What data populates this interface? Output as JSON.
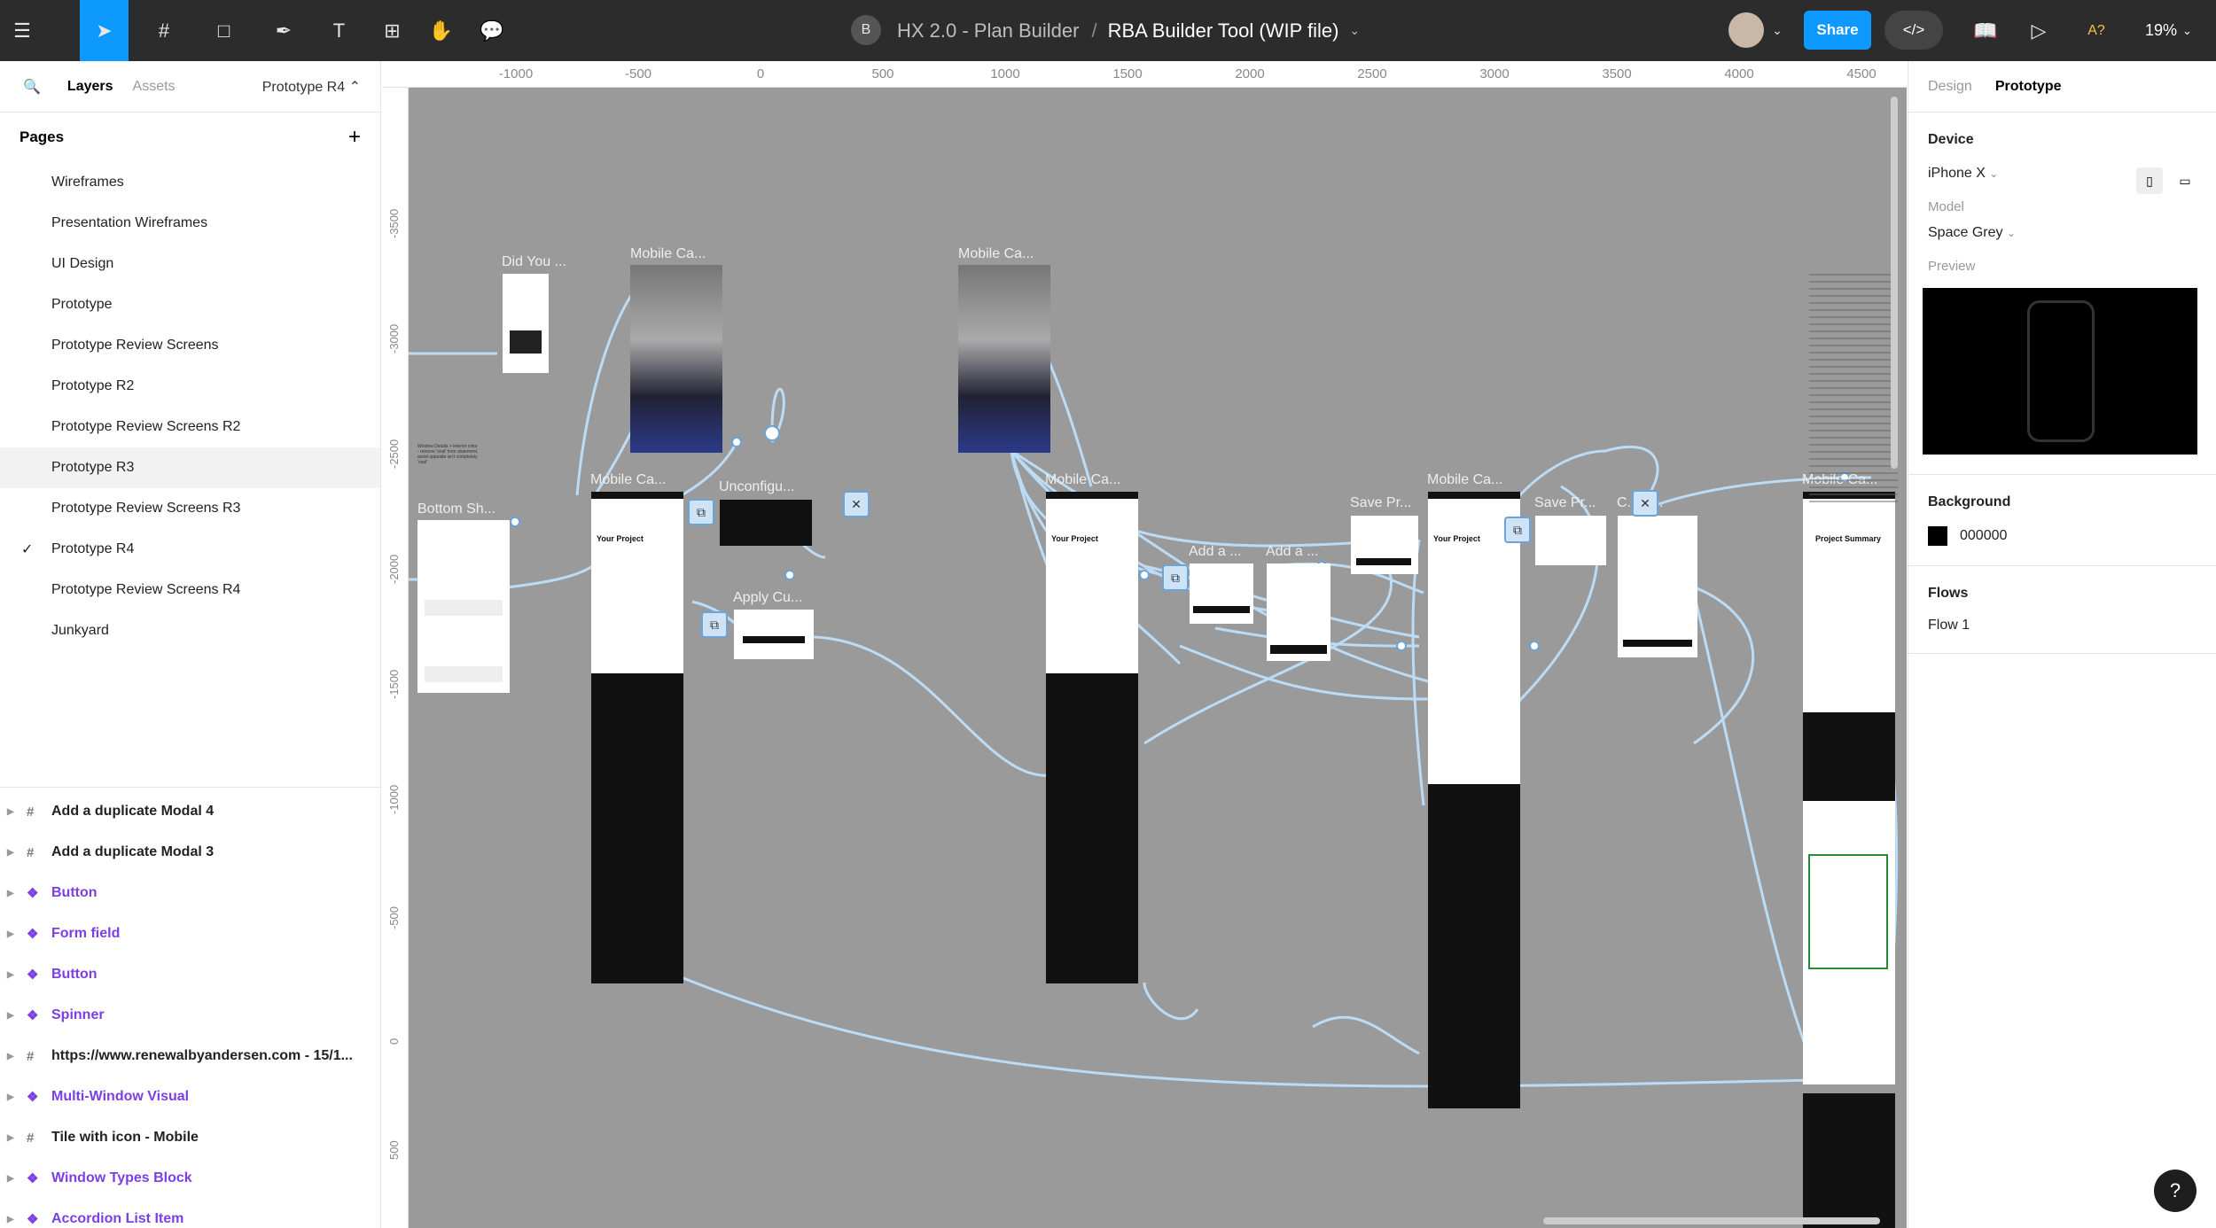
{
  "toolbar": {
    "user_initial": "B",
    "project": "HX 2.0 - Plan Builder",
    "separator": "/",
    "file": "RBA Builder Tool (WIP file)",
    "share_label": "Share",
    "zoom": "19%",
    "font_warning": "A?"
  },
  "left_panel": {
    "tab_layers": "Layers",
    "tab_assets": "Assets",
    "current_page": "Prototype R4",
    "pages_heading": "Pages",
    "pages": [
      "Wireframes",
      "Presentation Wireframes",
      "UI Design",
      "Prototype",
      "Prototype Review Screens",
      "Prototype R2",
      "Prototype Review Screens R2",
      "Prototype R3",
      "Prototype Review Screens R3",
      "Prototype R4",
      "Prototype Review Screens R4",
      "Junkyard"
    ],
    "layers": [
      {
        "label": "Add a duplicate Modal 4",
        "kind": "frame"
      },
      {
        "label": "Add a duplicate Modal 3",
        "kind": "frame"
      },
      {
        "label": "Button",
        "kind": "component"
      },
      {
        "label": "Form field",
        "kind": "component"
      },
      {
        "label": "Button",
        "kind": "component"
      },
      {
        "label": "Spinner",
        "kind": "component"
      },
      {
        "label": "https://www.renewalbyandersen.com - 15/1...",
        "kind": "frame"
      },
      {
        "label": "Multi-Window Visual",
        "kind": "component"
      },
      {
        "label": "Tile with icon - Mobile",
        "kind": "frame"
      },
      {
        "label": "Window Types Block",
        "kind": "component"
      },
      {
        "label": "Accordion List Item",
        "kind": "component"
      }
    ]
  },
  "canvas": {
    "ruler_x": [
      "-1000",
      "-500",
      "0",
      "500",
      "1000",
      "1500",
      "2000",
      "2500",
      "3000",
      "3500",
      "4000",
      "4500"
    ],
    "ruler_y": [
      "-3500",
      "-3000",
      "-2500",
      "-2000",
      "-1500",
      "-1000",
      "-500",
      "0",
      "500"
    ],
    "frame_labels": {
      "did_you": "Did You ...",
      "mobile_ca_1": "Mobile Ca...",
      "mobile_ca_2": "Mobile Ca...",
      "bottom_sh": "Bottom Sh...",
      "mobile_ca_3": "Mobile Ca...",
      "unconfigu": "Unconfigu...",
      "apply_cu": "Apply Cu...",
      "mobile_ca_4": "Mobile Ca...",
      "add_a_1": "Add a ...",
      "add_a_2": "Add a ...",
      "save_pr_1": "Save Pr...",
      "mobile_ca_5": "Mobile Ca...",
      "save_pr_2": "Save Pr...",
      "c_a": "C... A...",
      "mobile_ca_6": "Mobile Ca..."
    },
    "screen_text": {
      "your_project": "Your Project",
      "project_summary": "Project Summary",
      "note_left": "Window Details > interior color - remove 'oval' from statement, avoid opposite isn't completely 'oval'"
    }
  },
  "right_panel": {
    "tab_design": "Design",
    "tab_prototype": "Prototype",
    "device_heading": "Device",
    "device_value": "iPhone X",
    "model_label": "Model",
    "model_value": "Space Grey",
    "preview_label": "Preview",
    "background_heading": "Background",
    "background_value": "000000",
    "flows_heading": "Flows",
    "flow_item": "Flow 1"
  },
  "colors": {
    "accent": "#0d99ff",
    "canvas": "#9a9a9a",
    "connector": "#b8d8f2",
    "component": "#7b3fe4"
  }
}
